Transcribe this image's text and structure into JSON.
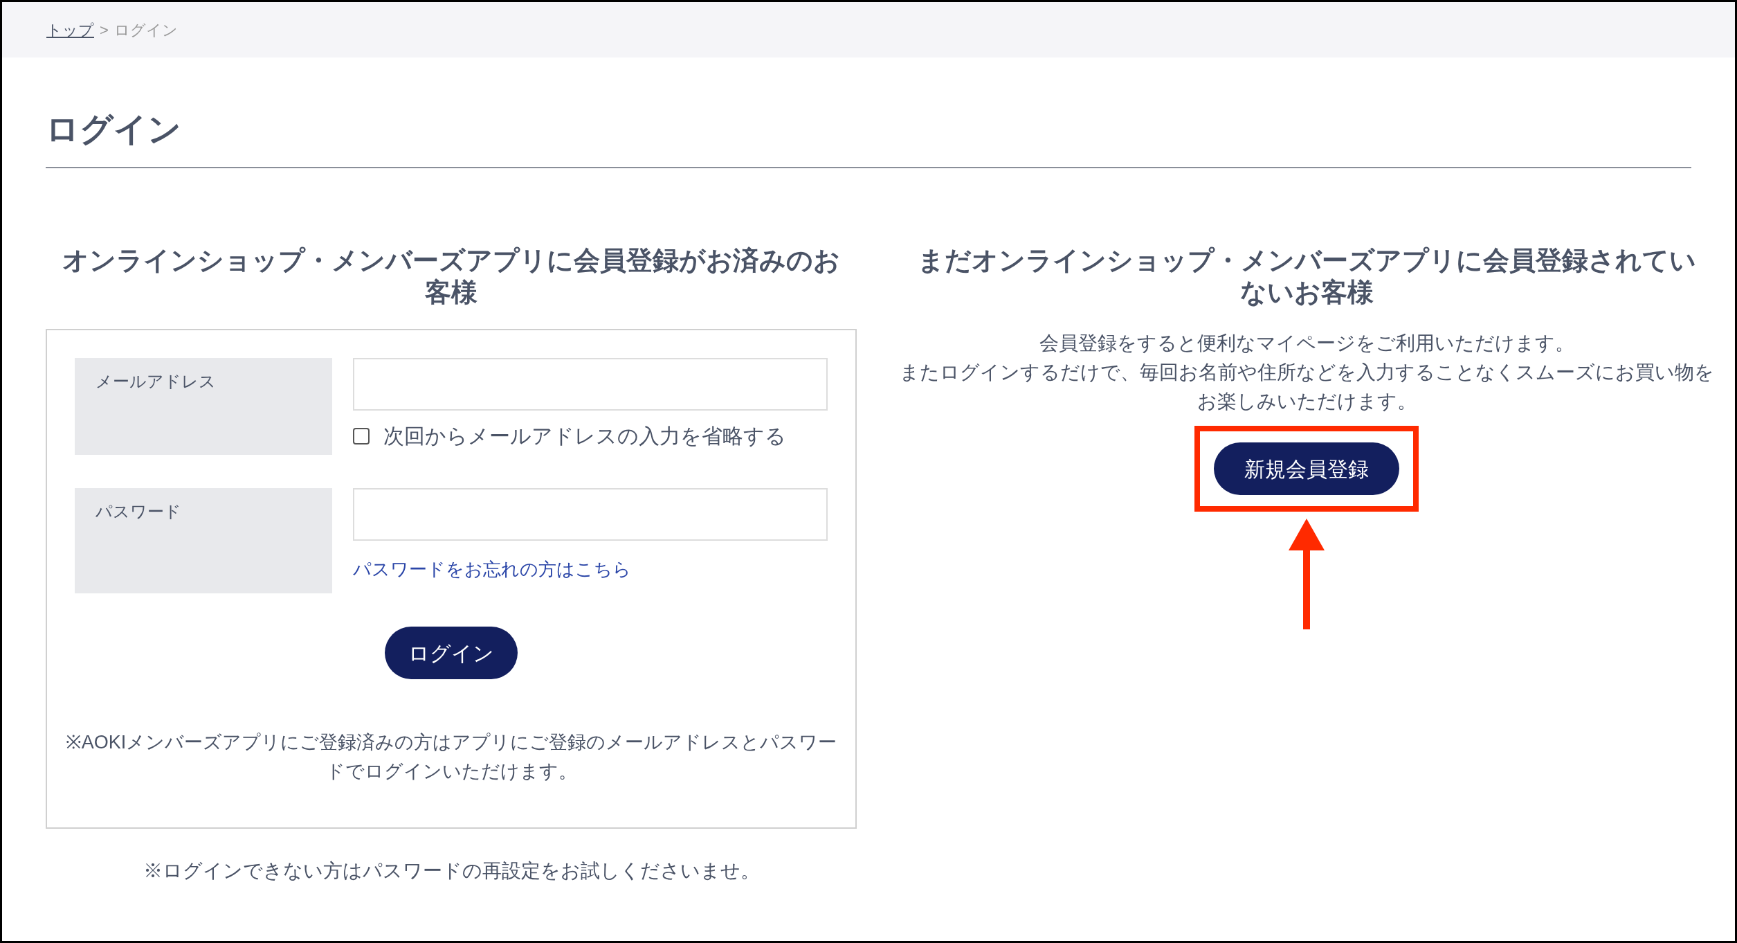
{
  "breadcrumb": {
    "link": "トップ",
    "separator": ">",
    "current": "ログイン"
  },
  "page_title": "ログイン",
  "login_section": {
    "heading": "オンラインショップ・メンバーズアプリに会員登録がお済みのお客様",
    "email": {
      "label": "メールアドレス",
      "remember": {
        "label": "次回からメールアドレスの入力を省略する",
        "checked": false
      }
    },
    "password": {
      "label": "パスワード",
      "forgot_link": "パスワードをお忘れの方はこちら"
    },
    "login_button": "ログイン",
    "note": "※AOKIメンバーズアプリにご登録済みの方はアプリにご登録のメールアドレスとパスワードでログインいただけます。"
  },
  "login_footnote": "※ログインできない方はパスワードの再設定をお試しくださいませ。",
  "register_section": {
    "heading": "まだオンラインショップ・メンバーズアプリに会員登録されていないお客様",
    "description": [
      "会員登録をすると便利なマイページをご利用いただけます。",
      "またログインするだけで、毎回お名前や住所などを入力することなくスムーズにお買い物をお楽しみいただけます。"
    ],
    "register_button": "新規会員登録"
  }
}
